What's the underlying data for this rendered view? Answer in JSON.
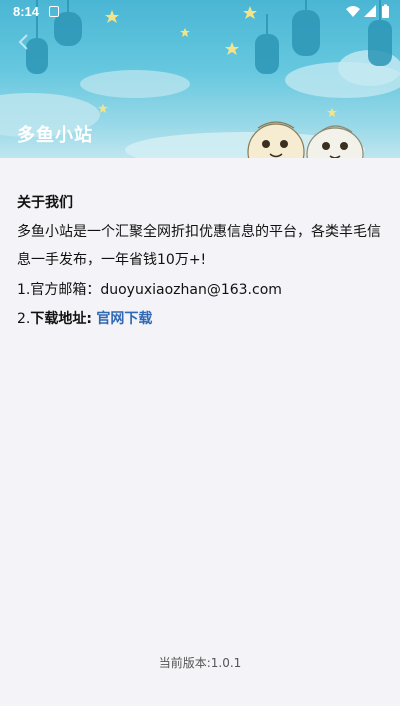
{
  "status_bar": {
    "time": "8:14"
  },
  "header": {
    "title": "多鱼小站",
    "back_icon": "back-arrow-icon"
  },
  "content": {
    "about_heading": "关于我们",
    "about_text": "多鱼小站是一个汇聚全网折扣优惠信息的平台，各类羊毛信息一手发布，一年省钱10万+!",
    "email_line": "1.官方邮箱：duoyuxiaozhan@163.com",
    "download_prefix": "2.",
    "download_label": "下载地址:",
    "download_link": "官网下载",
    "version": "当前版本:1.0.1"
  },
  "colors": {
    "header_top": "#4ab6d4",
    "link": "#2f68b5",
    "background": "#f4f3f7"
  }
}
